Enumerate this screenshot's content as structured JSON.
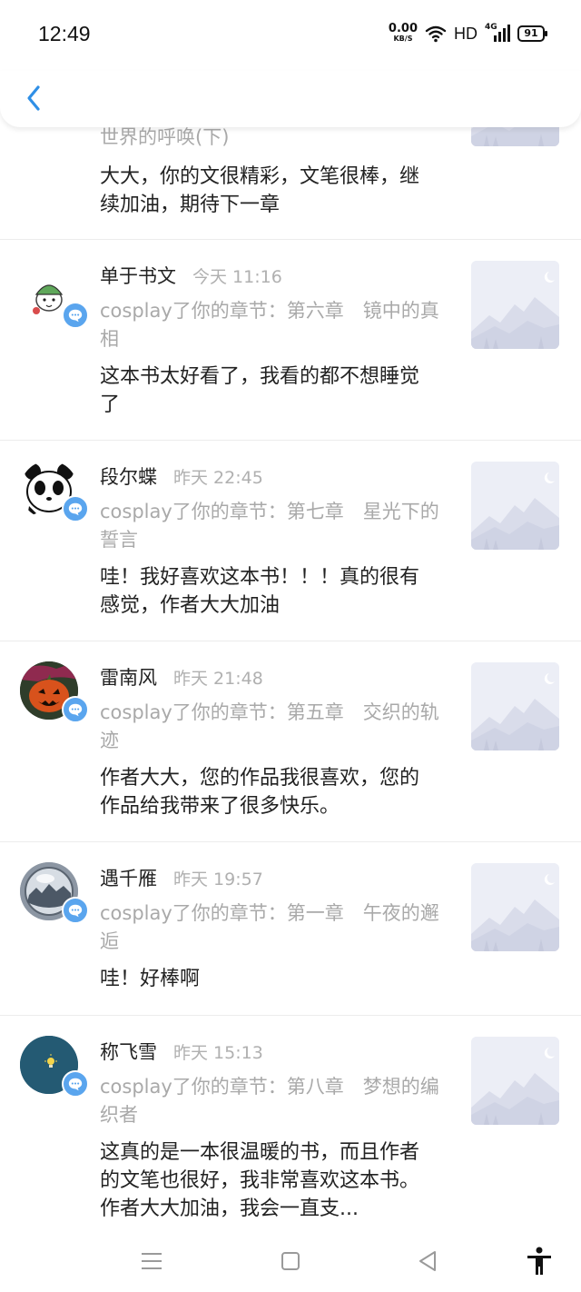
{
  "status": {
    "time": "12:49",
    "speed_value": "0.00",
    "speed_unit": "KB/S",
    "hd": "HD",
    "network": "4G",
    "battery": "91"
  },
  "header": {
    "back_icon": "chevron-left-icon"
  },
  "items": [
    {
      "chapter": "世界的呼唤(下)",
      "comment": "大大，你的文很精彩，文笔很棒，继续加油，期待下一章"
    },
    {
      "name": "单于书文",
      "when": "今天 11:16",
      "chapter": "cosplay了你的章节：第六章　镜中的真相",
      "comment": "这本书太好看了，我看的都不想睡觉了"
    },
    {
      "name": "段尔蝶",
      "when": "昨天 22:45",
      "chapter": "cosplay了你的章节：第七章　星光下的誓言",
      "comment": "哇！我好喜欢这本书！！！真的很有感觉，作者大大加油"
    },
    {
      "name": "雷南风",
      "when": "昨天 21:48",
      "chapter": "cosplay了你的章节：第五章　交织的轨迹",
      "comment": "作者大大，您的作品我很喜欢，您的作品给我带来了很多快乐。"
    },
    {
      "name": "遇千雁",
      "when": "昨天 19:57",
      "chapter": "cosplay了你的章节：第一章　午夜的邂逅",
      "comment": "哇！好棒啊"
    },
    {
      "name": "称飞雪",
      "when": "昨天 15:13",
      "chapter": "cosplay了你的章节：第八章　梦想的编织者",
      "comment": "这真的是一本很温暖的书，而且作者的文笔也很好，我非常喜欢这本书。作者大大加油，我会一直支..."
    }
  ],
  "nav": {
    "menu_icon": "menu-icon",
    "home_icon": "home-square-icon",
    "back_icon": "back-triangle-icon",
    "accessibility_icon": "accessibility-icon"
  }
}
